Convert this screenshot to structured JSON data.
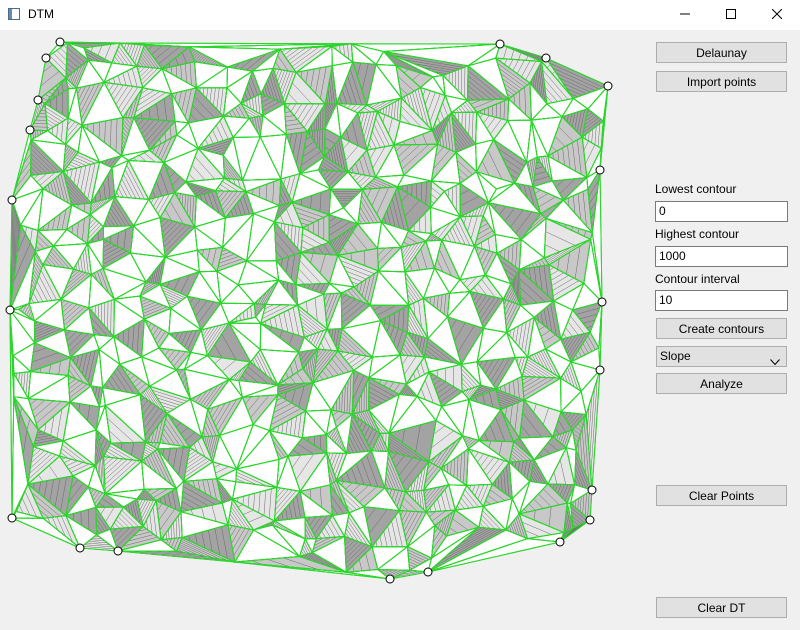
{
  "window": {
    "title": "DTM",
    "controls": {
      "minimize_icon": "minimize-icon",
      "maximize_icon": "maximize-icon",
      "close_icon": "close-icon"
    }
  },
  "panel": {
    "delaunay_label": "Delaunay",
    "import_label": "Import points",
    "lowest_contour_label": "Lowest contour",
    "lowest_contour_value": "0",
    "highest_contour_label": "Highest contour",
    "highest_contour_value": "1000",
    "contour_interval_label": "Contour interval",
    "contour_interval_value": "10",
    "create_contours_label": "Create contours",
    "analysis_select_value": "Slope",
    "analyze_label": "Analyze",
    "clear_points_label": "Clear Points",
    "clear_dt_label": "Clear DT"
  },
  "colors": {
    "window_bg": "#f0f0f0",
    "triangulation_edge": "#2bd62b",
    "slope_dark": "#a3a3a3",
    "slope_mid": "#c8c8c8",
    "slope_light": "#e6e6e6",
    "slope_flat": "#ffffff",
    "contour_line": "#6a6a6a",
    "point_marker": "#000000"
  }
}
